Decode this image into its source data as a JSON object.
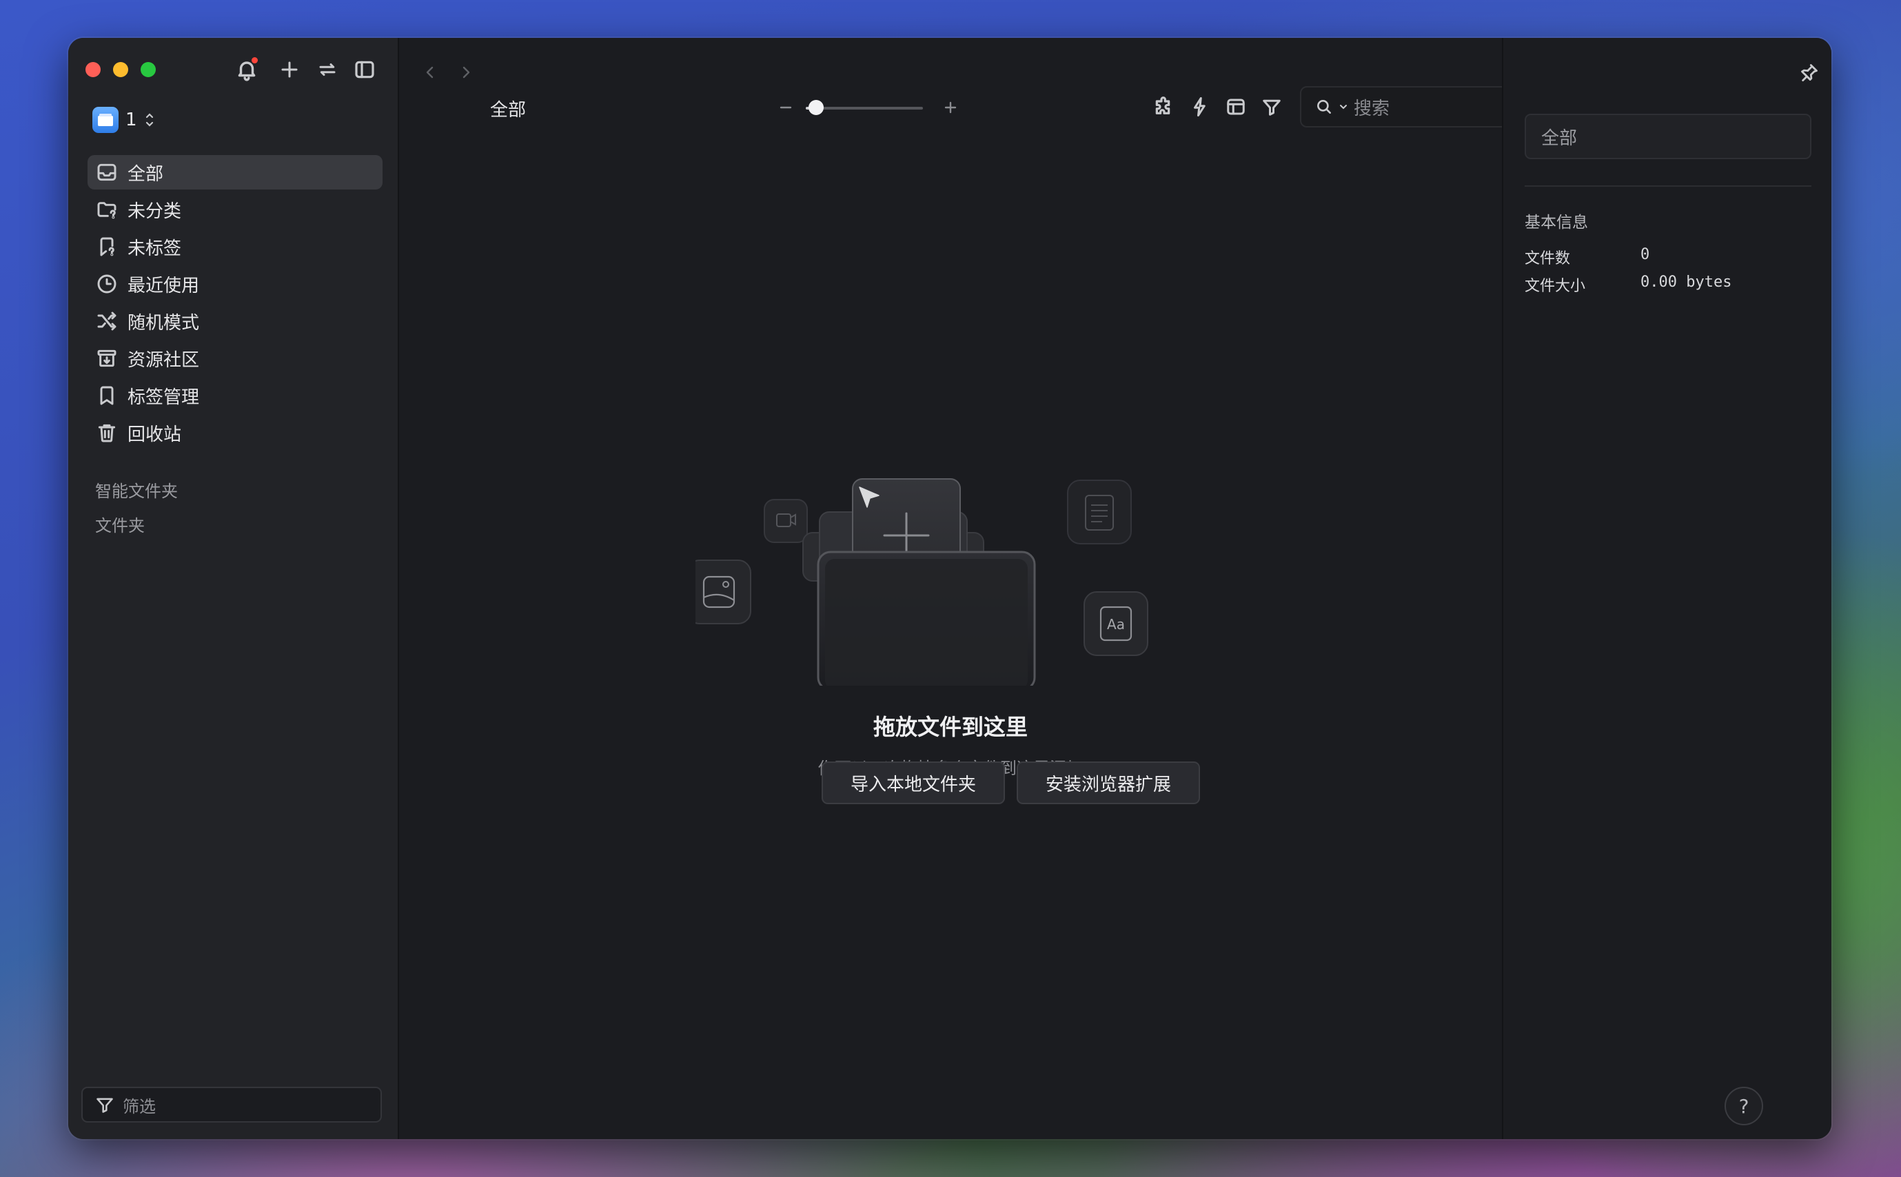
{
  "window": {
    "traffic_lights": {
      "close": "#ff5f57",
      "minimize": "#febc2e",
      "zoom": "#28c840"
    },
    "notification_dot_color": "#ff453a"
  },
  "sidebar": {
    "toolbar_icons": [
      "bell-icon",
      "plus-icon",
      "swap-arrows-icon",
      "sidebar-toggle-icon"
    ],
    "library_name": "1",
    "nav": [
      {
        "label": "全部",
        "icon": "inbox-icon",
        "active": true
      },
      {
        "label": "未分类",
        "icon": "folder-question-icon",
        "active": false
      },
      {
        "label": "未标签",
        "icon": "tag-question-icon",
        "active": false
      },
      {
        "label": "最近使用",
        "icon": "clock-icon",
        "active": false
      },
      {
        "label": "随机模式",
        "icon": "shuffle-icon",
        "active": false
      },
      {
        "label": "资源社区",
        "icon": "archive-download-icon",
        "active": false
      },
      {
        "label": "标签管理",
        "icon": "bookmark-icon",
        "active": false
      },
      {
        "label": "回收站",
        "icon": "trash-icon",
        "active": false
      }
    ],
    "smart_folders_label": "智能文件夹",
    "folders_label": "文件夹",
    "filter_placeholder": "筛选"
  },
  "toolbar": {
    "breadcrumb": "全部",
    "zoom_level": 0.09,
    "right_icons": [
      "puzzle-icon",
      "bolt-icon",
      "layout-icon",
      "filter-icon"
    ],
    "search_placeholder": "搜索"
  },
  "empty_state": {
    "title": "拖放文件到这里",
    "subtitle": "你可以一次拖拽多个文件到这里添加",
    "import_button": "导入本地文件夹",
    "extension_button": "安装浏览器扩展",
    "font_card_text": "Aa"
  },
  "inspector": {
    "name_value": "全部",
    "heading": "基本信息",
    "file_count_label": "文件数",
    "file_count_value": "0",
    "file_size_label": "文件大小",
    "file_size_value": "0.00 bytes",
    "help_label": "?"
  }
}
